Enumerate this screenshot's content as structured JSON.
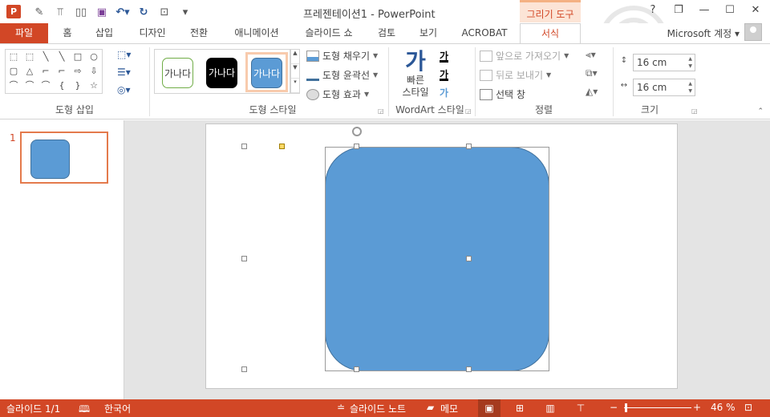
{
  "titlebar": {
    "app_icon": "P",
    "window_title": "프레젠테이션1 - PowerPoint",
    "contextual_tab": "그리기 도구",
    "help": "?",
    "restore": "❐",
    "minimize": "—",
    "maximize": "☐",
    "close": "✕"
  },
  "tabs": {
    "file": "파일",
    "items": [
      "홈",
      "삽입",
      "디자인",
      "전환",
      "애니메이션",
      "슬라이드 쇼",
      "검토",
      "보기",
      "ACROBAT",
      "서식"
    ],
    "account": "Microsoft 계정 ▾"
  },
  "ribbon": {
    "insert_shapes": {
      "label": "도형 삽입",
      "gallery": [
        "⬚",
        "⬚",
        "╲",
        "╲",
        "□",
        "○",
        "▢",
        "△",
        "⌐",
        "⌐",
        "⇨",
        "⇩",
        "⌒",
        "⌒",
        "⌒",
        "{",
        "}",
        "☆"
      ]
    },
    "shape_styles": {
      "label": "도형 스타일",
      "thumb_text": "가나다",
      "fill": "도형 채우기",
      "outline": "도형 윤곽선",
      "effects": "도형 효과"
    },
    "wordart": {
      "label": "WordArt 스타일",
      "quick_styles_icon": "가",
      "quick_styles_line1": "빠른",
      "quick_styles_line2": "스타일",
      "text_fill": "가",
      "text_outline": "가",
      "text_effects": "가"
    },
    "arrange": {
      "label": "정렬",
      "bring_forward": "앞으로 가져오기",
      "send_backward": "뒤로 보내기",
      "selection_pane": "선택 창"
    },
    "size": {
      "label": "크기",
      "height": "16 cm",
      "width": "16 cm"
    }
  },
  "thumbnails": {
    "slide_number": "1"
  },
  "statusbar": {
    "slide_info": "슬라이드 1/1",
    "language": "한국어",
    "notes": "슬라이드 노트",
    "comments": "메모",
    "zoom": "46 %",
    "zoom_minus": "−",
    "zoom_plus": "+"
  },
  "colors": {
    "accent": "#d24726",
    "shape_fill": "#5b9bd5"
  }
}
